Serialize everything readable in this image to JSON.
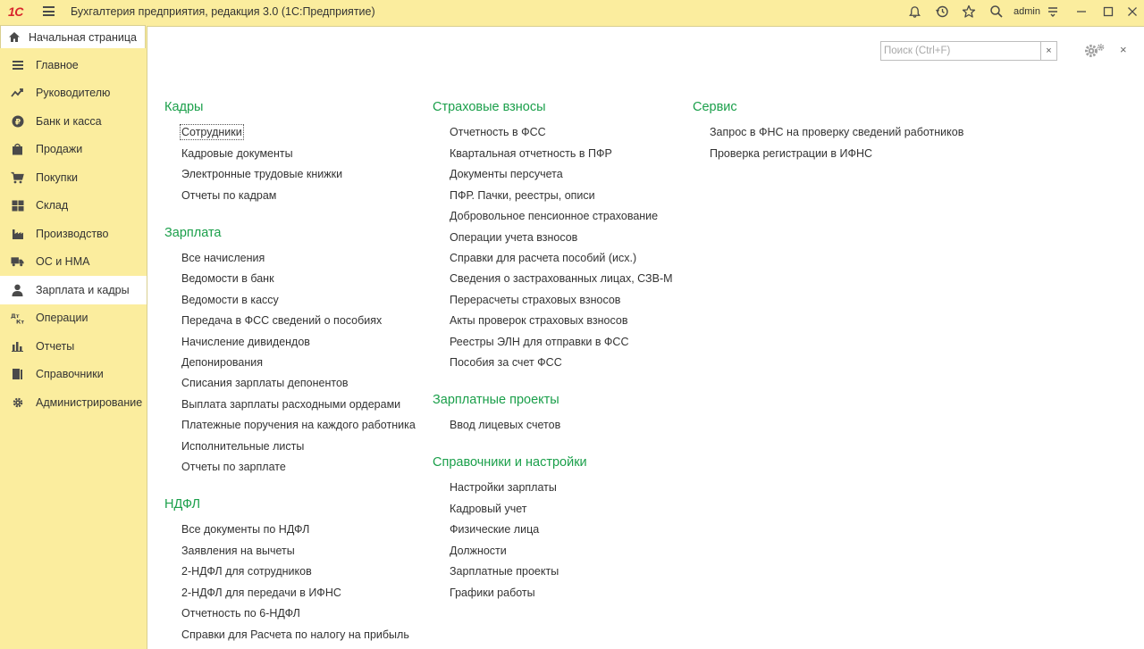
{
  "app": {
    "logo": "1С",
    "title": "Бухгалтерия предприятия, редакция 3.0  (1С:Предприятие)",
    "user": "admin"
  },
  "tab": {
    "home_label": "Начальная страница"
  },
  "sidebar": {
    "items": [
      {
        "label": "Главное",
        "icon": "menu-list-icon"
      },
      {
        "label": "Руководителю",
        "icon": "trend-icon"
      },
      {
        "label": "Банк и касса",
        "icon": "ruble-coin-icon"
      },
      {
        "label": "Продажи",
        "icon": "shopping-bag-icon"
      },
      {
        "label": "Покупки",
        "icon": "cart-icon"
      },
      {
        "label": "Склад",
        "icon": "warehouse-grid-icon"
      },
      {
        "label": "Производство",
        "icon": "factory-icon"
      },
      {
        "label": "ОС и НМА",
        "icon": "truck-icon"
      },
      {
        "label": "Зарплата и кадры",
        "icon": "person-icon",
        "active": true
      },
      {
        "label": "Операции",
        "icon": "dt-kt-icon"
      },
      {
        "label": "Отчеты",
        "icon": "bar-chart-icon"
      },
      {
        "label": "Справочники",
        "icon": "books-icon"
      },
      {
        "label": "Администрирование",
        "icon": "gear-icon"
      }
    ]
  },
  "search": {
    "placeholder": "Поиск (Ctrl+F)",
    "clear": "×"
  },
  "panel_close": "×",
  "sections": {
    "kadry": {
      "title": "Кадры",
      "links": [
        "Сотрудники",
        "Кадровые документы",
        "Электронные трудовые книжки",
        "Отчеты по кадрам"
      ]
    },
    "zarplata": {
      "title": "Зарплата",
      "links": [
        "Все начисления",
        "Ведомости в банк",
        "Ведомости в кассу",
        "Передача в ФСС сведений о пособиях",
        "Начисление дивидендов",
        "Депонирования",
        "Списания зарплаты депонентов",
        "Выплата зарплаты расходными ордерами",
        "Платежные поручения на каждого работника",
        "Исполнительные листы",
        "Отчеты по зарплате"
      ]
    },
    "ndfl": {
      "title": "НДФЛ",
      "links": [
        "Все документы по НДФЛ",
        "Заявления на вычеты",
        "2-НДФЛ для сотрудников",
        "2-НДФЛ для передачи в ИФНС",
        "Отчетность по 6-НДФЛ",
        "Справки для Расчета по налогу на прибыль"
      ]
    },
    "strakh": {
      "title": "Страховые взносы",
      "links": [
        "Отчетность в ФСС",
        "Квартальная отчетность в ПФР",
        "Документы персучета",
        "ПФР. Пачки, реестры, описи",
        "Добровольное пенсионное страхование",
        "Операции учета взносов",
        "Справки для расчета пособий (исх.)",
        "Сведения о застрахованных лицах, СЗВ-М",
        "Перерасчеты страховых взносов",
        "Акты проверок страховых взносов",
        "Реестры ЭЛН для отправки в ФСС",
        "Пособия за счет ФСС"
      ]
    },
    "proekty": {
      "title": "Зарплатные проекты",
      "links": [
        "Ввод лицевых счетов"
      ]
    },
    "sprav": {
      "title": "Справочники и настройки",
      "links": [
        "Настройки зарплаты",
        "Кадровый учет",
        "Физические лица",
        "Должности",
        "Зарплатные проекты",
        "Графики работы"
      ]
    },
    "servis": {
      "title": "Сервис",
      "links": [
        "Запрос в ФНС на проверку сведений работников",
        "Проверка регистрации в ИФНС"
      ]
    }
  },
  "colors": {
    "accent_yellow": "#fbed9e",
    "section_green": "#1a9f4a",
    "logo_red": "#d8262d"
  }
}
